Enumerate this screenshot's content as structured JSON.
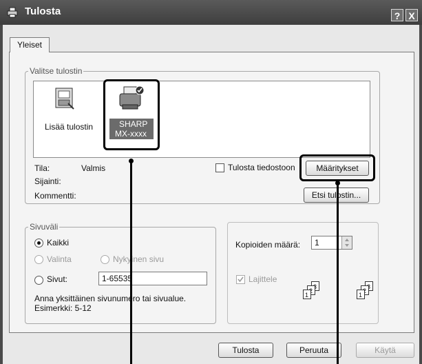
{
  "window": {
    "title": "Tulosta",
    "help_button": "?",
    "close_button": "X"
  },
  "tabs": [
    {
      "label": "Yleiset"
    }
  ],
  "select_printer": {
    "group_label": "Valitse tulostin",
    "printers": [
      {
        "label": "Lisää tulostin"
      },
      {
        "label_line1": "SHARP",
        "label_line2": "MX-xxxx"
      }
    ]
  },
  "status": {
    "status_label": "Tila:",
    "status_value": "Valmis",
    "location_label": "Sijainti:",
    "comment_label": "Kommentti:",
    "print_to_file_label": "Tulosta tiedostoon",
    "preferences_button": "Määritykset",
    "find_printer_button": "Etsi tulostin..."
  },
  "page_range": {
    "group_label": "Sivuväli",
    "all_label": "Kaikki",
    "selection_label": "Valinta",
    "current_page_label": "Nykyinen sivu",
    "pages_label": "Sivut:",
    "pages_value": "1-65535",
    "hint_line1": "Anna yksittäinen sivunumero tai sivualue.",
    "hint_line2": "Esimerkki: 5-12"
  },
  "copies": {
    "copies_label": "Kopioiden määrä:",
    "copies_value": "1",
    "collate_label": "Lajittele"
  },
  "buttons": {
    "print": "Tulosta",
    "cancel": "Peruuta",
    "apply": "Käytä"
  }
}
